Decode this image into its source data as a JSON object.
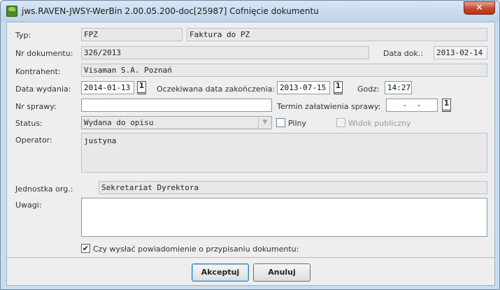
{
  "window": {
    "title": "jws.RAVEN-JWSY-WerBin 2.00.05.200-doc[25987] Cofnięcie dokumentu",
    "icon": "raven-app-icon",
    "close_label": "✕"
  },
  "form": {
    "typ": {
      "label": "Typ:",
      "code": "FPZ",
      "name": "Faktura do PZ"
    },
    "nr_dokumentu": {
      "label": "Nr dokumentu:",
      "value": "326/2013"
    },
    "data_dok": {
      "label": "Data dok.:",
      "value": "2013-02-14"
    },
    "kontrahent": {
      "label": "Kontrahent:",
      "value": "Visaman S.A. Poznań"
    },
    "data_wydania": {
      "label": "Data wydania:",
      "value": "2014-01-13"
    },
    "oczekiwana_data": {
      "label": "Oczekiwana data zakończenia:",
      "value": "2013-07-15"
    },
    "godz": {
      "label": "Godz:",
      "value": "14:27"
    },
    "nr_sprawy": {
      "label": "Nr sprawy:",
      "value": ""
    },
    "termin": {
      "label": "Termin załatwienia sprawy:",
      "value": "  -  -  "
    },
    "status": {
      "label": "Status:",
      "value": "Wydana do opisu"
    },
    "pilny": {
      "label": "Pilny",
      "checked": false
    },
    "widok_publiczny": {
      "label": "Widok publiczny",
      "checked": false
    },
    "operator": {
      "label": "Operator:",
      "value": "justyna"
    },
    "jednostka": {
      "label": "Jednostka org.:",
      "value": "Sekretariat Dyrektora"
    },
    "uwagi": {
      "label": "Uwagi:",
      "value": ""
    },
    "powiadomienie": {
      "label": "Czy wysłać powiadomienie o przypisaniu dokumentu:",
      "checked": true,
      "mark": "✔"
    },
    "calendar_glyph": "1"
  },
  "buttons": {
    "accept": "Akceptuj",
    "cancel": "Anuluj"
  }
}
